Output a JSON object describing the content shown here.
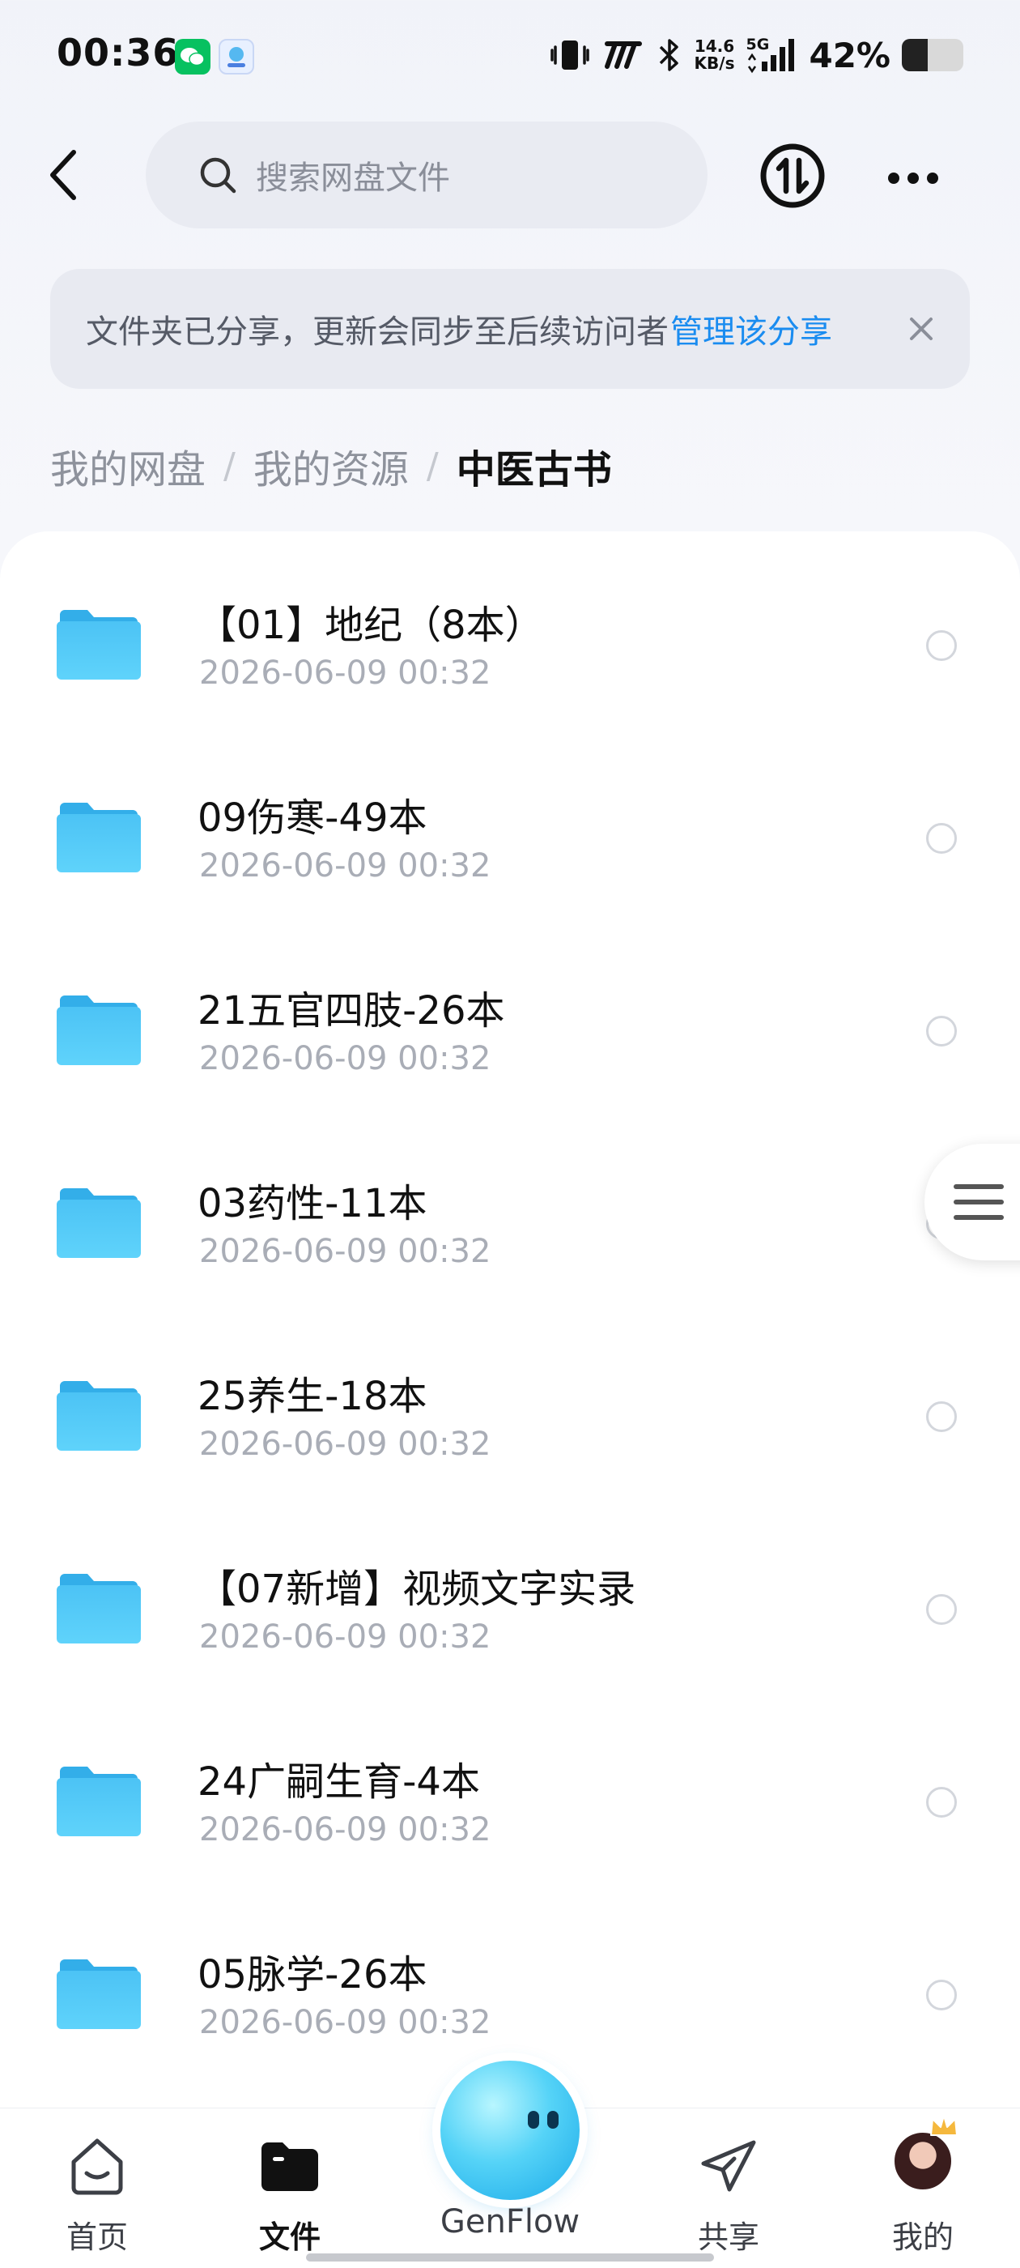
{
  "status_bar": {
    "time": "00:36",
    "network_speed_value": "14.6",
    "network_speed_unit": "KB/s",
    "signal_label": "5G",
    "battery_percent_text": "42%",
    "battery_level": 0.42,
    "notification_apps": [
      "wechat-icon",
      "genflow-app-icon"
    ]
  },
  "header": {
    "search_placeholder": "搜索网盘文件"
  },
  "share_banner": {
    "message": "文件夹已分享，更新会同步至后续访问者",
    "link_label": "管理该分享"
  },
  "breadcrumb": {
    "items": [
      "我的网盘",
      "我的资源"
    ],
    "current": "中医古书",
    "separator": "/"
  },
  "files": [
    {
      "name": "【01】地纪（8本）",
      "date": "2026-06-09  00:32"
    },
    {
      "name": "09伤寒-49本",
      "date": "2026-06-09  00:32"
    },
    {
      "name": "21五官四肢-26本",
      "date": "2026-06-09  00:32"
    },
    {
      "name": "03药性-11本",
      "date": "2026-06-09  00:32"
    },
    {
      "name": "25养生-18本",
      "date": "2026-06-09  00:32"
    },
    {
      "name": "【07新增】视频文字实录",
      "date": "2026-06-09  00:32"
    },
    {
      "name": "24广嗣生育-4本",
      "date": "2026-06-09  00:32"
    },
    {
      "name": "05脉学-26本",
      "date": "2026-06-09  00:32"
    }
  ],
  "bottom_nav": {
    "home": "首页",
    "files": "文件",
    "genflow": "GenFlow",
    "share": "共享",
    "mine": "我的",
    "active": "files"
  },
  "colors": {
    "accent": "#1a8cf0",
    "folder": "#4cc3f5",
    "muted_text": "#a9adb6"
  }
}
